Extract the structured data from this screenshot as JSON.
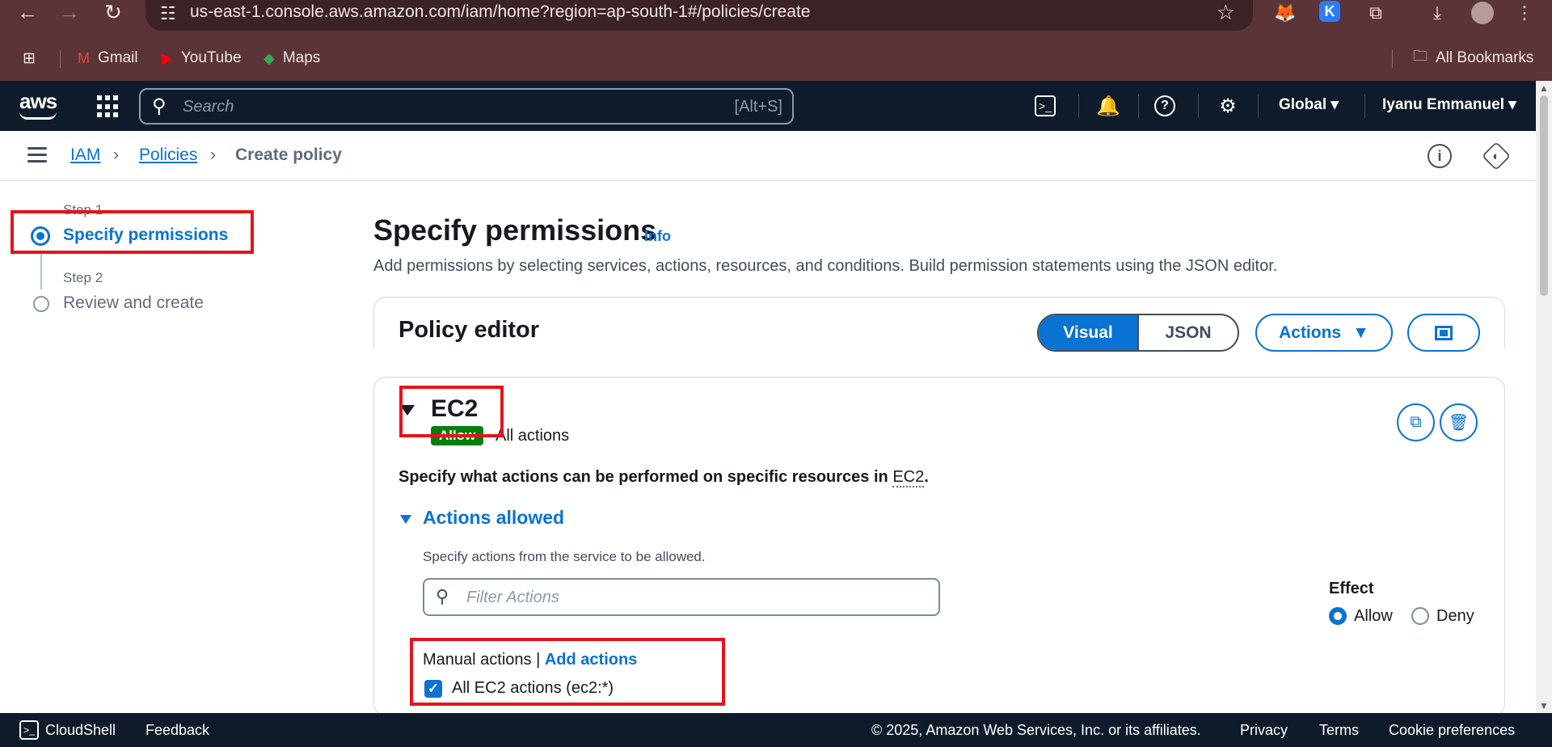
{
  "browser": {
    "url": "us-east-1.console.aws.amazon.com/iam/home?region=ap-south-1#/policies/create",
    "bookmarks": [
      {
        "label": "Gmail",
        "icon": "gmail-icon"
      },
      {
        "label": "YouTube",
        "icon": "youtube-icon"
      },
      {
        "label": "Maps",
        "icon": "maps-icon"
      }
    ],
    "all_bookmarks": "All Bookmarks"
  },
  "aws_nav": {
    "logo": "aws",
    "search_placeholder": "Search",
    "search_shortcut": "[Alt+S]",
    "region": "Global",
    "user": "Iyanu Emmanuel"
  },
  "breadcrumb": {
    "items": [
      "IAM",
      "Policies",
      "Create policy"
    ]
  },
  "steps": [
    {
      "label": "Step 1",
      "title": "Specify permissions",
      "active": true
    },
    {
      "label": "Step 2",
      "title": "Review and create",
      "active": false
    }
  ],
  "main": {
    "title": "Specify permissions",
    "info": "Info",
    "description": "Add permissions by selecting services, actions, resources, and conditions. Build permission statements using the JSON editor.",
    "policy_editor": {
      "title": "Policy editor",
      "mode_visual": "Visual",
      "mode_json": "JSON",
      "selected_mode": "Visual",
      "actions_button": "Actions"
    },
    "statement": {
      "service": "EC2",
      "badge": "Allow",
      "summary": "All actions",
      "instruction_prefix": "Specify what actions can be performed on specific resources in ",
      "instruction_service": "EC2",
      "instruction_suffix": ".",
      "actions_allowed": "Actions allowed",
      "actions_hint": "Specify actions from the service to be allowed.",
      "filter_placeholder": "Filter Actions",
      "filter_value": "",
      "effect_label": "Effect",
      "effect_allow": "Allow",
      "effect_deny": "Deny",
      "effect_selected": "Allow",
      "manual_actions": "Manual actions",
      "separator": "|",
      "add_actions": "Add actions",
      "all_actions_checkbox": "All EC2 actions (ec2:*)",
      "all_actions_checked": true
    }
  },
  "footer": {
    "cloudshell": "CloudShell",
    "feedback": "Feedback",
    "copyright": "© 2025, Amazon Web Services, Inc. or its affiliates.",
    "privacy": "Privacy",
    "terms": "Terms",
    "cookies": "Cookie preferences"
  },
  "colors": {
    "aws_nav_bg": "#0f1b2a",
    "accent_blue": "#0972d3",
    "allow_green": "#037f0c",
    "highlight_red": "#e3141c",
    "browser_frame": "#5a3438"
  }
}
